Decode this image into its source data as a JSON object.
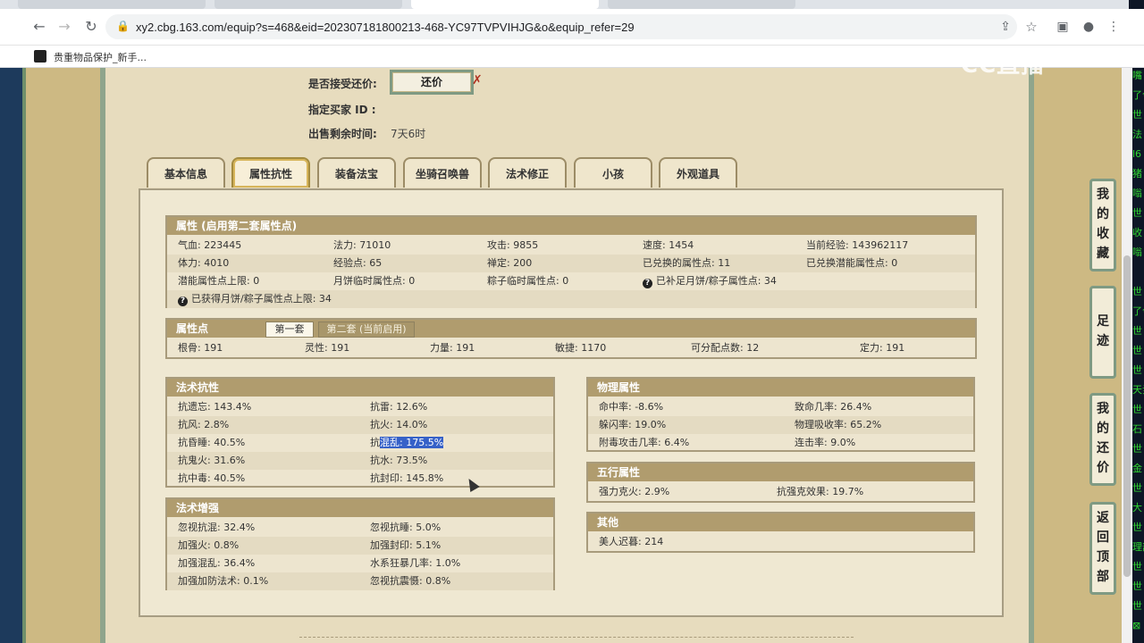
{
  "browser": {
    "url": "xy2.cbg.163.com/equip?s=468&eid=202307181800213-468-YC97TVPVIHJG&o&equip_refer=29",
    "bookmark": "贵重物品保护_新手..."
  },
  "watermark": "CC直播",
  "listing": {
    "accept_offer_label": "是否接受还价:",
    "offer_button": "还价",
    "buyer_id_label": "指定买家 ID :",
    "time_left_label": "出售剩余时间:",
    "time_left_value": "7天6时"
  },
  "tabs": [
    "基本信息",
    "属性抗性",
    "装备法宝",
    "坐骑召唤兽",
    "法术修正",
    "小孩",
    "外观道具"
  ],
  "attributes": {
    "title": "属性 (启用第二套属性点)",
    "rows": [
      [
        "气血: 223445",
        "法力: 71010",
        "攻击: 9855",
        "速度: 1454",
        "当前经验: 143962117"
      ],
      [
        "体力: 4010",
        "经验点: 65",
        "禅定: 200",
        "已兑换的属性点: 11",
        "已兑换潜能属性点: 0"
      ],
      [
        "潜能属性点上限: 0",
        "月饼临时属性点: 0",
        "粽子临时属性点: 0",
        "已补足月饼/粽子属性点: 34"
      ],
      [
        "已获得月饼/粽子属性点上限: 34"
      ]
    ]
  },
  "stat_points": {
    "title": "属性点",
    "set1": "第一套",
    "set2": "第二套 (当前启用)",
    "values": [
      "根骨: 191",
      "灵性: 191",
      "力量: 191",
      "敏捷: 1170",
      "可分配点数: 12",
      "定力: 191"
    ]
  },
  "spell_resist": {
    "title": "法术抗性",
    "rows": [
      [
        "抗遗忘: 143.4%",
        "抗雷: 12.6%"
      ],
      [
        "抗风: 2.8%",
        "抗火: 14.0%"
      ],
      [
        "抗昏睡: 40.5%",
        "抗",
        "混乱: 175.5%"
      ],
      [
        "抗鬼火: 31.6%",
        "抗水: 73.5%"
      ],
      [
        "抗中毒: 40.5%",
        "抗封印: 145.8%"
      ]
    ]
  },
  "spell_boost": {
    "title": "法术增强",
    "rows": [
      [
        "忽视抗混: 32.4%",
        "忽视抗睡: 5.0%"
      ],
      [
        "加强火: 0.8%",
        "加强封印: 5.1%"
      ],
      [
        "加强混乱: 36.4%",
        "水系狂暴几率: 1.0%"
      ],
      [
        "加强加防法术: 0.1%",
        "忽视抗震慑: 0.8%"
      ]
    ]
  },
  "physical": {
    "title": "物理属性",
    "rows": [
      [
        "命中率: -8.6%",
        "致命几率: 26.4%"
      ],
      [
        "躲闪率: 19.0%",
        "物理吸收率: 65.2%"
      ],
      [
        "附毒攻击几率: 6.4%",
        "连击率: 9.0%"
      ]
    ]
  },
  "five_elements": {
    "title": "五行属性",
    "rows": [
      [
        "强力克火: 2.9%",
        "抗强克效果: 19.7%"
      ]
    ]
  },
  "other": {
    "title": "其他",
    "rows": [
      [
        "美人迟暮: 214"
      ]
    ]
  },
  "side_buttons": [
    "我的收藏",
    "足迹",
    "我的还价",
    "返回顶部"
  ],
  "right_column": [
    "嘴",
    "了今",
    "世",
    "法",
    "l6",
    "猪",
    "嗡",
    "世",
    "收",
    "嗡",
    "",
    "世",
    "了今",
    "世",
    "世",
    "世",
    "天尹",
    "世",
    "石",
    "世",
    "金",
    "世",
    "大",
    "世",
    "理部",
    "世",
    "世",
    "世",
    "⊠"
  ]
}
